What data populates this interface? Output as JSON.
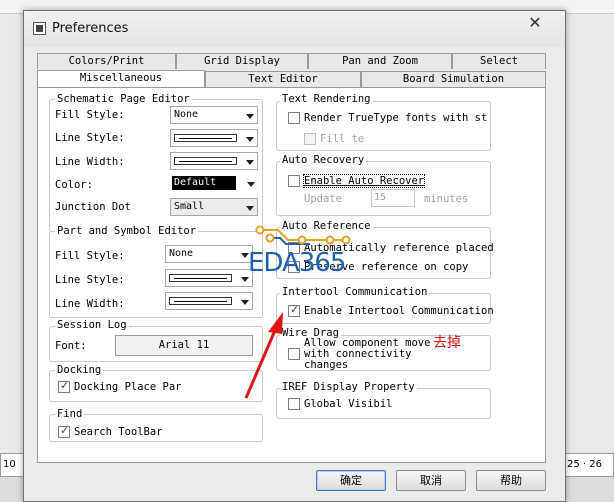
{
  "window": {
    "title": "Preferences",
    "close": "✕"
  },
  "bg": {
    "ruler_left": "10",
    "ruler_right": "25 · 26"
  },
  "tabs_row1": [
    "Colors/Print",
    "Grid Display",
    "Pan and Zoom",
    "Select"
  ],
  "tabs_row2": [
    "Miscellaneous",
    "Text Editor",
    "Board Simulation"
  ],
  "schematic": {
    "title": "Schematic Page Editor",
    "fill_style_label": "Fill Style:",
    "fill_style_value": "None",
    "line_style_label": "Line Style:",
    "line_width_label": "Line Width:",
    "color_label": "Color:",
    "color_value": "Default",
    "junction_dot_label": "Junction Dot",
    "junction_dot_value": "Small"
  },
  "part_symbol": {
    "title": "Part and Symbol Editor",
    "fill_style_label": "Fill Style:",
    "fill_style_value": "None",
    "line_style_label": "Line Style:",
    "line_width_label": "Line Width:"
  },
  "session_log": {
    "title": "Session Log",
    "font_label": "Font:",
    "font_value": "Arial 11"
  },
  "docking": {
    "title": "Docking",
    "option": "Docking Place Par",
    "checked": true
  },
  "find": {
    "title": "Find",
    "option": "Search ToolBar",
    "checked": true
  },
  "text_rendering": {
    "title": "Text Rendering",
    "option": "Render TrueType fonts with str",
    "checked": false,
    "fill": "Fill te"
  },
  "auto_recovery": {
    "title": "Auto Recovery",
    "option": "Enable Auto Recover",
    "checked": false,
    "update_label": "Update",
    "update_value": "15",
    "minutes": "minutes"
  },
  "auto_reference": {
    "title": "Auto Reference",
    "opt1": "Automatically reference placed",
    "opt2": "Preserve reference on copy"
  },
  "intertool": {
    "title": "Intertool Communication",
    "option": "Enable Intertool Communication",
    "checked": true
  },
  "wire_drag": {
    "title": "Wire Drag",
    "line1": "Allow component move",
    "line2": "with connectivity",
    "line3": "changes"
  },
  "iref": {
    "title": "IREF Display Property",
    "option": "Global Visibil"
  },
  "annotation": {
    "note": "去掉",
    "watermark": "EDA365"
  },
  "buttons": {
    "ok": "确定",
    "cancel": "取消",
    "help": "帮助"
  },
  "colors": {
    "arrow": "#e01515",
    "watermark": "#1f5fb0",
    "pcb_trace": "#e6a020"
  }
}
